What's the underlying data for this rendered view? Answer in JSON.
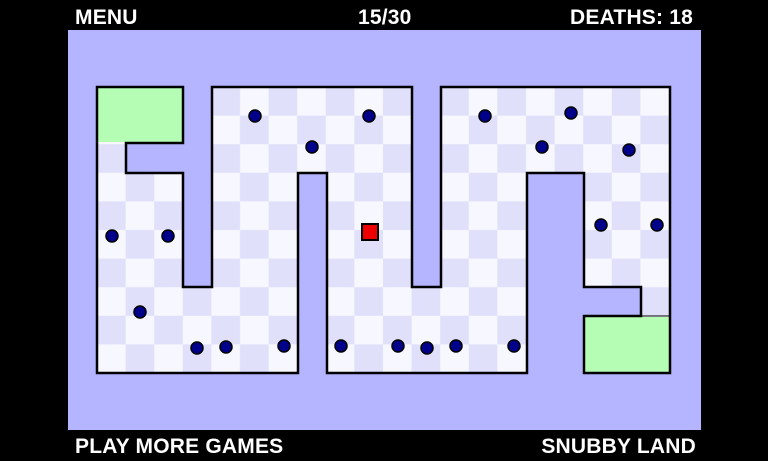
{
  "hud": {
    "menu_label": "MENU",
    "level": "15/30",
    "deaths": "DEATHS: 18",
    "play_more_label": "PLAY MORE GAMES",
    "brand_label": "SNUBBY LAND"
  },
  "colors": {
    "background": "#000000",
    "board": "#b4b5fe",
    "tile_light": "#f7f7ff",
    "tile_dark": "#e0e0fa",
    "safe_zone": "#b5fdb5",
    "wall": "#000000",
    "enemy_fill": "#00008b",
    "player_fill": "#ee0000"
  },
  "game": {
    "player": "red-square",
    "enemy": "blue-dot",
    "enemy_count": 21
  }
}
